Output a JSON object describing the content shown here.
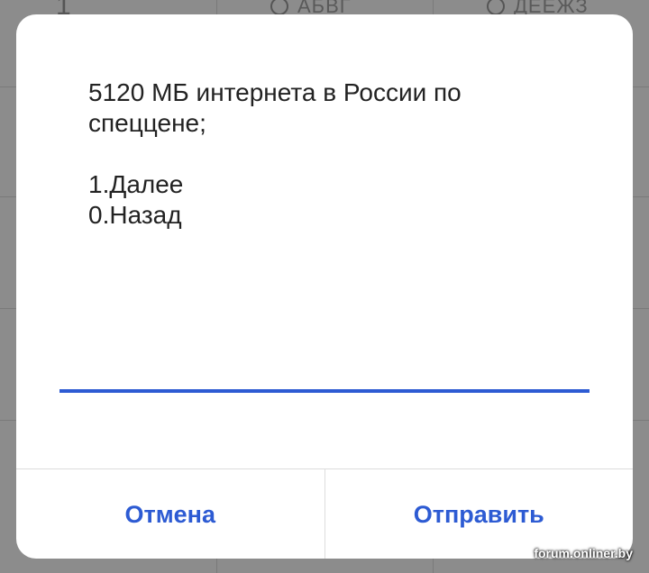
{
  "background_keypad": {
    "key_1": "1",
    "key_2_letters": "АБВГ",
    "key_3_letters": "ДЕЁЖЗ"
  },
  "dialog": {
    "message": "5120 МБ интернета в России по спецценe;\n\n1.Далее\n0.Назад",
    "input": {
      "value": "",
      "placeholder": ""
    },
    "buttons": {
      "cancel_label": "Отмена",
      "send_label": "Отправить"
    }
  },
  "watermark": "forum.onliner.by",
  "colors": {
    "accent": "#2d5bd3",
    "dialog_bg": "#ffffff",
    "text": "#222222"
  }
}
